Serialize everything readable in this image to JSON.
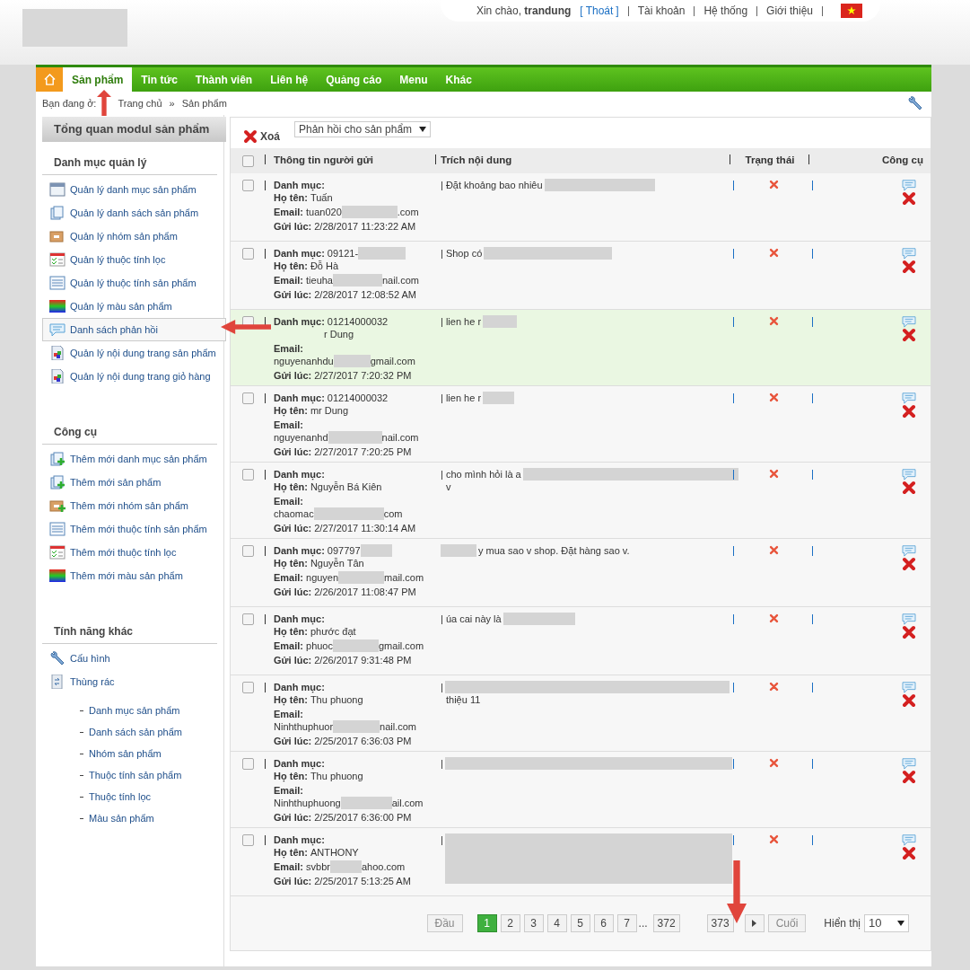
{
  "top_bar": {
    "greeting": "Xin chào, **trandung**",
    "logout_open": "[",
    "logout": "Thoát",
    "logout_close": "]",
    "links": [
      "Tài khoản",
      "Hệ thống",
      "Giới thiệu"
    ]
  },
  "nav": {
    "tabs": [
      {
        "label": "Sản phẩm",
        "selected": true
      },
      {
        "label": "Tin tức",
        "selected": false
      },
      {
        "label": "Thành viên",
        "selected": false
      },
      {
        "label": "Liên hệ",
        "selected": false
      },
      {
        "label": "Quảng cáo",
        "selected": false
      },
      {
        "label": "Menu",
        "selected": false
      },
      {
        "label": "Khác",
        "selected": false
      }
    ]
  },
  "breadcrumb": {
    "prefix": "Bạn đang ở:",
    "items": [
      "Trang chủ",
      "Sản phẩm"
    ],
    "separator": "»"
  },
  "sidebar": {
    "title": "Tổng quan modul sản phẩm",
    "sections": [
      {
        "heading": "Danh mục quản lý",
        "items": [
          {
            "label": "Quản lý danh mục sản phẩm",
            "selected": false
          },
          {
            "label": "Quản lý danh sách sản phẩm",
            "selected": false
          },
          {
            "label": "Quản lý nhóm sản phẩm",
            "selected": false
          },
          {
            "label": "Quản lý thuộc tính lọc",
            "selected": false
          },
          {
            "label": "Quản lý thuộc tính sản phẩm",
            "selected": false
          },
          {
            "label": "Quản lý màu sản phẩm",
            "selected": false
          },
          {
            "label": "Danh sách phản hồi",
            "selected": true
          },
          {
            "label": "Quản lý nội dung trang sản phẩm",
            "selected": false
          },
          {
            "label": "Quản lý nội dung trang giỏ hàng",
            "selected": false
          }
        ]
      },
      {
        "heading": "Công cụ",
        "items": [
          {
            "label": "Thêm mới danh mục sản phẩm",
            "selected": false
          },
          {
            "label": "Thêm mới sản phẩm",
            "selected": false
          },
          {
            "label": "Thêm mới nhóm sản phẩm",
            "selected": false
          },
          {
            "label": "Thêm mới thuộc tính sản phẩm",
            "selected": false
          },
          {
            "label": "Thêm mới thuộc tính lọc",
            "selected": false
          },
          {
            "label": "Thêm mới màu sản phẩm",
            "selected": false
          }
        ]
      },
      {
        "heading": "Tính năng khác",
        "items": [
          {
            "label": "Cấu hình",
            "selected": false
          },
          {
            "label": "Thùng rác",
            "selected": false
          }
        ]
      }
    ],
    "trash_items": [
      "Danh mục sản phẩm",
      "Danh sách sản phẩm",
      "Nhóm sản phẩm",
      "Thuộc tính sản phẩm",
      "Thuộc tính lọc",
      "Màu sản phẩm"
    ]
  },
  "toolbar": {
    "delete": "Xoá",
    "filter": "Phản hồi cho sản phẩm"
  },
  "table": {
    "columns": [
      "Thông tin người gửi",
      "Trích nội dung",
      "Trạng thái",
      "Công cụ"
    ],
    "select_all_checked": false,
    "rows": [
      {
        "highlighted": false,
        "fields": [
          {
            "label": "Danh mục:"
          },
          {
            "label": "Họ tên:",
            "parts": [
              {
                "kind": "text",
                "text": "Tuấn"
              }
            ]
          },
          {
            "label": "Email:",
            "inline": true,
            "parts": [
              {
                "kind": "text",
                "text": "tuan020"
              },
              {
                "kind": "redaction"
              },
              {
                "kind": "text",
                "text": ".com"
              }
            ]
          },
          {
            "label": "Gửi lúc:",
            "parts": [
              {
                "kind": "text",
                "text": "2/28/2017 11:23:22 AM"
              }
            ]
          }
        ],
        "excerpt": [
          {
            "kind": "text",
            "text": "| Đặt khoảng bao nhiêu"
          },
          {
            "kind": "redaction"
          }
        ]
      },
      {
        "highlighted": false,
        "fields": [
          {
            "label": "Danh mục:",
            "parts": [
              {
                "kind": "text",
                "text": "09121-"
              },
              {
                "kind": "redaction"
              }
            ]
          },
          {
            "label": "Họ tên:",
            "parts": [
              {
                "kind": "text",
                "text": "Đỗ Hà"
              }
            ]
          },
          {
            "label": "Email:",
            "inline": true,
            "parts": [
              {
                "kind": "text",
                "text": "tieuha"
              },
              {
                "kind": "redaction"
              },
              {
                "kind": "text",
                "text": "nail.com"
              }
            ]
          },
          {
            "label": "Gửi lúc:",
            "parts": [
              {
                "kind": "text",
                "text": "2/28/2017 12:08:52 AM"
              }
            ]
          }
        ],
        "excerpt": [
          {
            "kind": "text",
            "text": "| Shop có"
          },
          {
            "kind": "redaction"
          }
        ]
      },
      {
        "highlighted": true,
        "fields": [
          {
            "label": "Danh mục:",
            "parts": [
              {
                "kind": "text",
                "text": "01214000032"
              }
            ]
          },
          {
            "parts": [
              {
                "kind": "text",
                "text": "r Dung"
              }
            ]
          },
          {
            "label": "Email:",
            "inline": false,
            "parts": [
              {
                "kind": "text",
                "text": "nguyenanhdu"
              },
              {
                "kind": "redaction"
              },
              {
                "kind": "text",
                "text": "gmail.com"
              }
            ]
          },
          {
            "label": "Gửi lúc:",
            "parts": [
              {
                "kind": "text",
                "text": "2/27/2017 7:20:32 PM"
              }
            ]
          }
        ],
        "excerpt": [
          {
            "kind": "text",
            "text": "| lien he r"
          },
          {
            "kind": "redaction"
          }
        ]
      },
      {
        "highlighted": false,
        "fields": [
          {
            "label": "Danh mục:",
            "parts": [
              {
                "kind": "text",
                "text": "01214000032"
              }
            ]
          },
          {
            "label": "Họ tên:",
            "parts": [
              {
                "kind": "text",
                "text": "mr Dung"
              }
            ]
          },
          {
            "label": "Email:",
            "inline": false,
            "parts": [
              {
                "kind": "text",
                "text": "nguyenanhd"
              },
              {
                "kind": "redaction"
              },
              {
                "kind": "text",
                "text": "nail.com"
              }
            ]
          },
          {
            "label": "Gửi lúc:",
            "parts": [
              {
                "kind": "text",
                "text": "2/27/2017 7:20:25 PM"
              }
            ]
          }
        ],
        "excerpt": [
          {
            "kind": "text",
            "text": "| lien he r"
          },
          {
            "kind": "redaction"
          }
        ]
      },
      {
        "highlighted": false,
        "fields": [
          {
            "label": "Danh mục:"
          },
          {
            "label": "Họ tên:",
            "parts": [
              {
                "kind": "text",
                "text": "Nguyễn Bá Kiên"
              }
            ]
          },
          {
            "label": "Email:",
            "inline": false,
            "parts": [
              {
                "kind": "text",
                "text": "chaomac"
              },
              {
                "kind": "redaction"
              },
              {
                "kind": "text",
                "text": "com"
              }
            ]
          },
          {
            "label": "Gửi lúc:",
            "parts": [
              {
                "kind": "text",
                "text": "2/27/2017 11:30:14 AM"
              }
            ]
          }
        ],
        "excerpt": [
          {
            "kind": "text",
            "text": "| cho mình hỏi là a"
          },
          {
            "kind": "redaction"
          }
        ],
        "excerpt2": "v"
      },
      {
        "highlighted": false,
        "fields": [
          {
            "label": "Danh mục:",
            "parts": [
              {
                "kind": "text",
                "text": "097797"
              },
              {
                "kind": "redaction"
              }
            ]
          },
          {
            "label": "Họ tên:",
            "parts": [
              {
                "kind": "text",
                "text": "Nguyễn Tân"
              }
            ]
          },
          {
            "label": "Email:",
            "inline": true,
            "parts": [
              {
                "kind": "text",
                "text": "nguyen"
              },
              {
                "kind": "redaction"
              },
              {
                "kind": "text",
                "text": "mail.com"
              }
            ]
          },
          {
            "label": "Gửi lúc:",
            "parts": [
              {
                "kind": "text",
                "text": "2/26/2017 11:08:47 PM"
              }
            ]
          }
        ],
        "excerpt": [
          {
            "kind": "redaction"
          },
          {
            "kind": "text",
            "text": "y mua sao v shop. Đặt hàng sao v."
          }
        ]
      },
      {
        "highlighted": false,
        "fields": [
          {
            "label": "Danh mục:"
          },
          {
            "label": "Họ tên:",
            "parts": [
              {
                "kind": "text",
                "text": "phước đạt"
              }
            ]
          },
          {
            "label": "Email:",
            "inline": true,
            "parts": [
              {
                "kind": "text",
                "text": "phuoc"
              },
              {
                "kind": "redaction"
              },
              {
                "kind": "text",
                "text": "gmail.com"
              }
            ]
          },
          {
            "label": "Gửi lúc:",
            "parts": [
              {
                "kind": "text",
                "text": "2/26/2017 9:31:48 PM"
              }
            ]
          }
        ],
        "excerpt": [
          {
            "kind": "text",
            "text": "| úa cai này là"
          },
          {
            "kind": "redaction"
          }
        ]
      },
      {
        "highlighted": false,
        "fields": [
          {
            "label": "Danh mục:"
          },
          {
            "label": "Họ tên:",
            "parts": [
              {
                "kind": "text",
                "text": "Thu phuong"
              }
            ]
          },
          {
            "label": "Email:",
            "inline": false,
            "parts": [
              {
                "kind": "text",
                "text": "Ninhthuphuor"
              },
              {
                "kind": "redaction"
              },
              {
                "kind": "text",
                "text": "nail.com"
              }
            ]
          },
          {
            "label": "Gửi lúc:",
            "parts": [
              {
                "kind": "text",
                "text": "2/25/2017 6:36:03 PM"
              }
            ]
          }
        ],
        "excerpt": [
          {
            "kind": "text",
            "text": "|"
          },
          {
            "kind": "redaction"
          }
        ],
        "excerpt2": "thiệu 11"
      },
      {
        "highlighted": false,
        "fields": [
          {
            "label": "Danh mục:"
          },
          {
            "label": "Họ tên:",
            "parts": [
              {
                "kind": "text",
                "text": "Thu phuong"
              }
            ]
          },
          {
            "label": "Email:",
            "inline": false,
            "parts": [
              {
                "kind": "text",
                "text": "Ninhthuphuong"
              },
              {
                "kind": "redaction"
              },
              {
                "kind": "text",
                "text": "ail.com"
              }
            ]
          },
          {
            "label": "Gửi lúc:",
            "parts": [
              {
                "kind": "text",
                "text": "2/25/2017 6:36:00 PM"
              }
            ]
          }
        ],
        "excerpt": [
          {
            "kind": "text",
            "text": "|"
          },
          {
            "kind": "redaction"
          }
        ]
      },
      {
        "highlighted": false,
        "fields": [
          {
            "label": "Danh mục:"
          },
          {
            "label": "Họ tên:",
            "parts": [
              {
                "kind": "text",
                "text": "ANTHONY"
              }
            ]
          },
          {
            "label": "Email:",
            "inline": true,
            "parts": [
              {
                "kind": "text",
                "text": "svbbr"
              },
              {
                "kind": "redaction"
              },
              {
                "kind": "text",
                "text": "ahoo.com"
              }
            ]
          },
          {
            "label": "Gửi lúc:",
            "parts": [
              {
                "kind": "text",
                "text": "2/25/2017 5:13:25 AM"
              }
            ]
          }
        ],
        "excerpt": [
          {
            "kind": "text",
            "text": "|"
          },
          {
            "kind": "redaction"
          }
        ]
      }
    ]
  },
  "pagination": {
    "first": "Đầu",
    "last": "Cuối",
    "ellipsis": "...",
    "pages": [
      {
        "label": "1",
        "selected": true
      },
      {
        "label": "2",
        "selected": false
      },
      {
        "label": "3",
        "selected": false
      },
      {
        "label": "4",
        "selected": false
      },
      {
        "label": "5",
        "selected": false
      },
      {
        "label": "6",
        "selected": false
      },
      {
        "label": "7",
        "selected": false
      },
      {
        "label": "372",
        "selected": false
      },
      {
        "label": "373",
        "selected": false
      }
    ],
    "show_label": "Hiển thị",
    "page_size": "10"
  }
}
